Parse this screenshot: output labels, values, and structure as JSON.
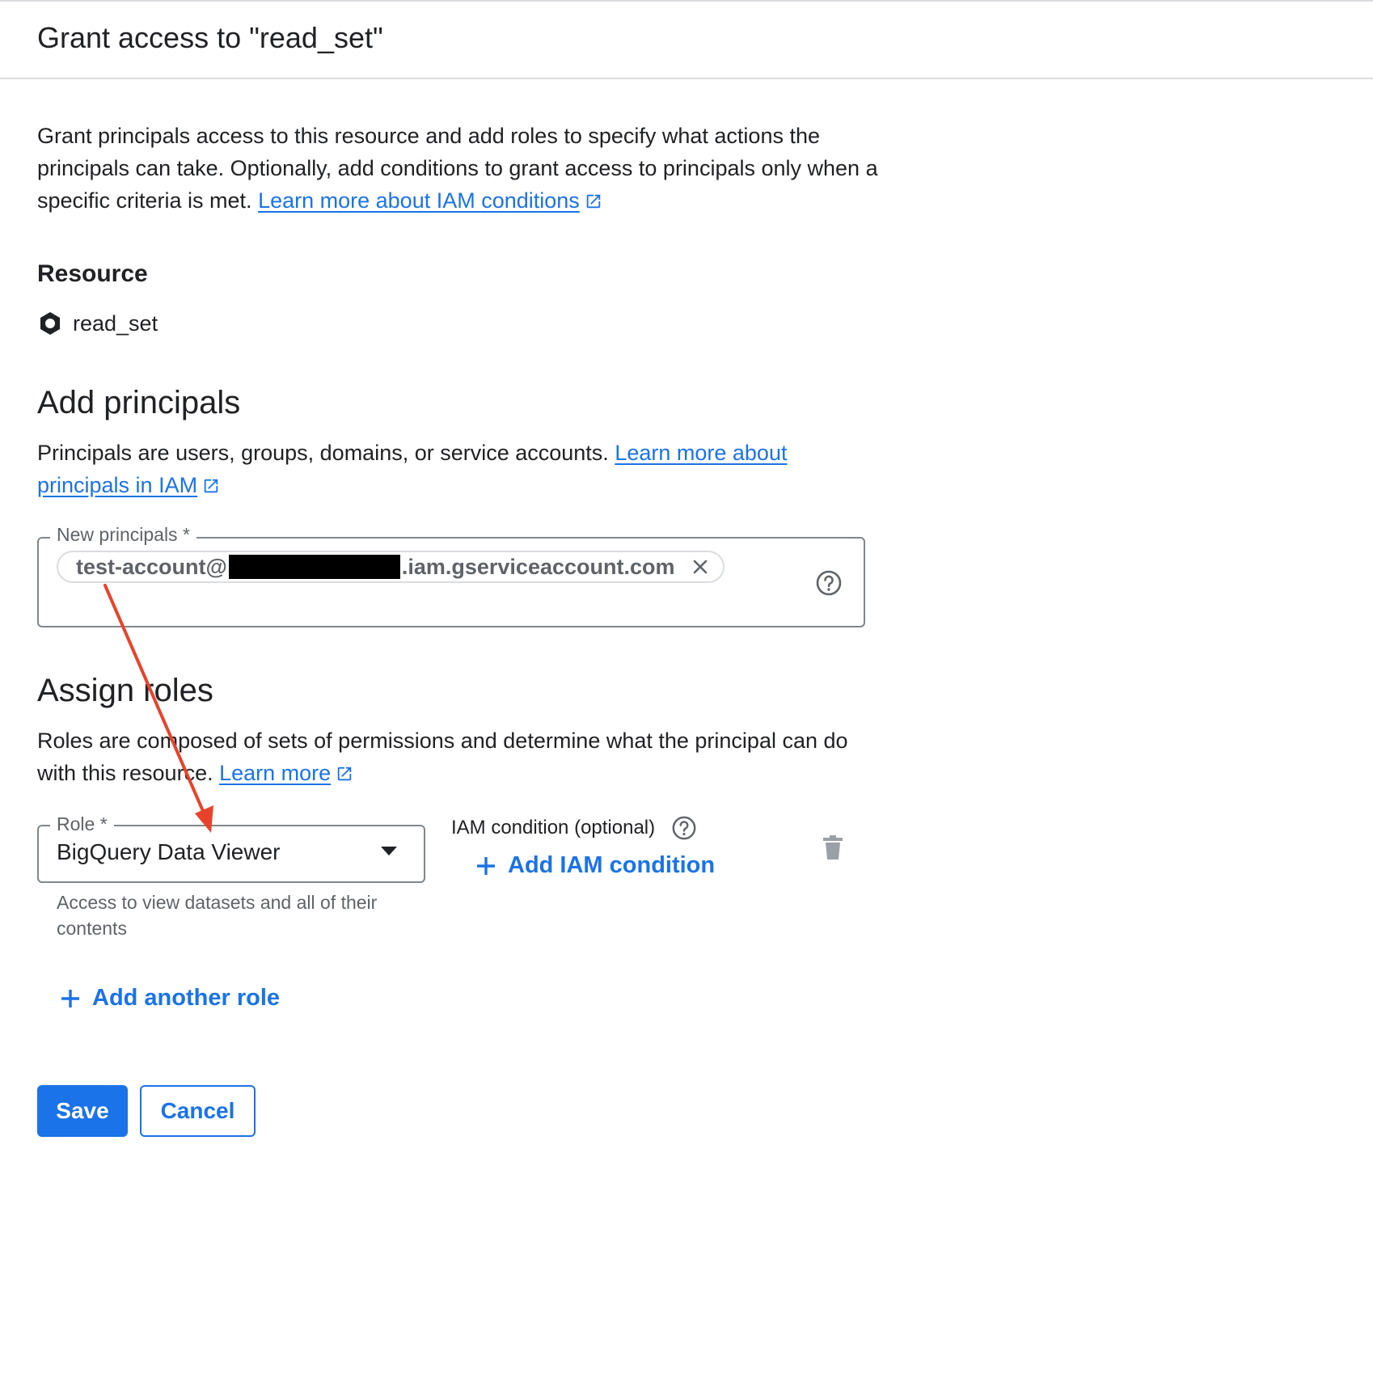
{
  "dialog": {
    "title": "Grant access to \"read_set\""
  },
  "intro": {
    "text": "Grant principals access to this resource and add roles to specify what actions the principals can take. Optionally, add conditions to grant access to principals only when a specific criteria is met.",
    "link": "Learn more about IAM conditions"
  },
  "resource": {
    "heading": "Resource",
    "icon": "dataset-hexagon-icon",
    "name": "read_set"
  },
  "principals": {
    "heading": "Add principals",
    "description": "Principals are users, groups, domains, or service accounts.",
    "link": "Learn more about principals in IAM",
    "field_label": "New principals *",
    "chip_prefix": "test-account@",
    "chip_suffix": ".iam.gserviceaccount.com"
  },
  "roles": {
    "heading": "Assign roles",
    "description": "Roles are composed of sets of permissions and determine what the principal can do with this resource.",
    "link": "Learn more",
    "role_label": "Role *",
    "role_value": "BigQuery Data Viewer",
    "role_helper": "Access to view datasets and all of their contents",
    "iam_condition_label": "IAM condition (optional)",
    "add_condition": "Add IAM condition",
    "add_another_role": "Add another role"
  },
  "actions": {
    "save": "Save",
    "cancel": "Cancel"
  },
  "colors": {
    "accent": "#1a73e8",
    "annotation_arrow": "#e8432a",
    "text": "#202124",
    "muted": "#5f6368"
  }
}
